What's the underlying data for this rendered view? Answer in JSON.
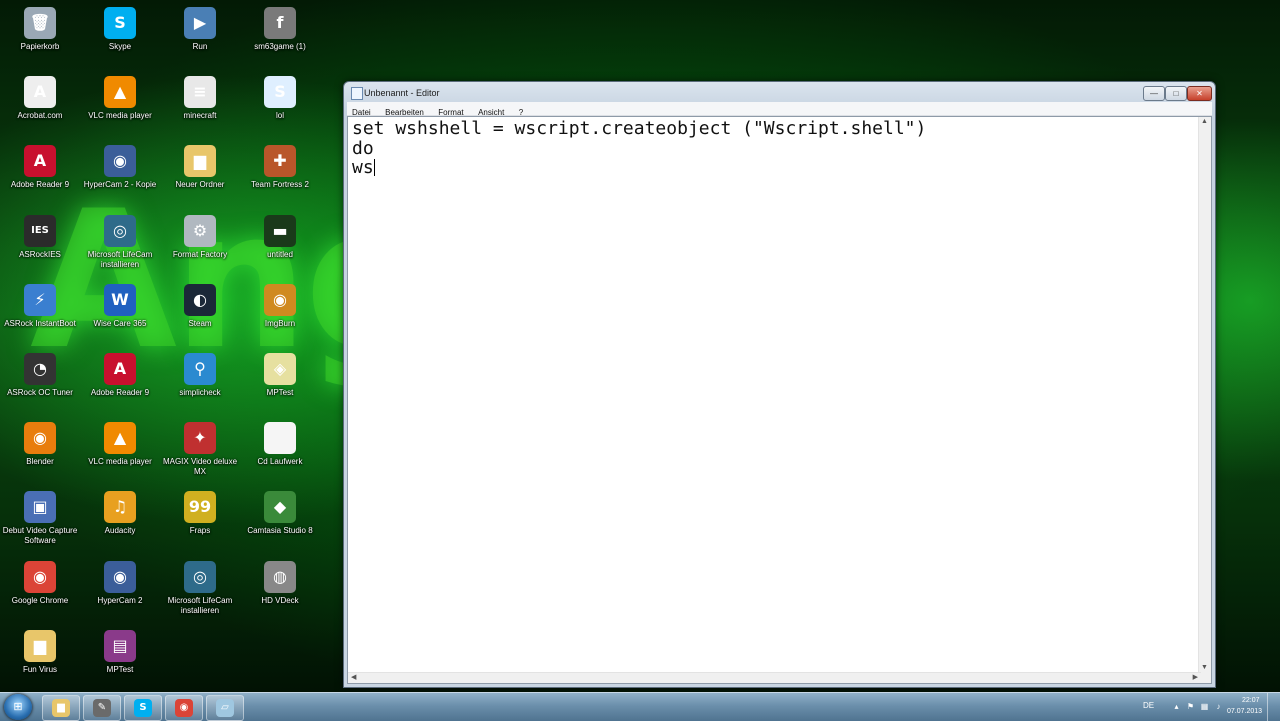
{
  "desktop": {
    "wallpaper_text": "Angry",
    "icons": [
      {
        "label": "Papierkorb",
        "icon": "recycle-bin-icon",
        "glyph": "🗑",
        "color": "#9aa8b5"
      },
      {
        "label": "Skype",
        "icon": "skype-icon",
        "glyph": "S",
        "color": "#00aff0"
      },
      {
        "label": "Run",
        "icon": "run-icon",
        "glyph": "▶",
        "color": "#4a7fb5"
      },
      {
        "label": "sm63game (1)",
        "icon": "flash-icon",
        "glyph": "f",
        "color": "#7a7a7a"
      },
      {
        "label": "Acrobat.com",
        "icon": "acrobat-icon",
        "glyph": "A",
        "color": "#eeeeee"
      },
      {
        "label": "VLC media player",
        "icon": "vlc-icon",
        "glyph": "▲",
        "color": "#f08a00"
      },
      {
        "label": "minecraft",
        "icon": "file-icon",
        "glyph": "≡",
        "color": "#e8e8e8"
      },
      {
        "label": "lol",
        "icon": "script-icon",
        "glyph": "S",
        "color": "#dfefff"
      },
      {
        "label": "Adobe Reader 9",
        "icon": "adobe-reader-icon",
        "glyph": "A",
        "color": "#c8102e"
      },
      {
        "label": "HyperCam 2 - Kopie",
        "icon": "hypercam-icon",
        "glyph": "◉",
        "color": "#3b5e99"
      },
      {
        "label": "Neuer Ordner",
        "icon": "folder-icon",
        "glyph": "▆",
        "color": "#e8c66a"
      },
      {
        "label": "Team Fortress 2",
        "icon": "tf2-icon",
        "glyph": "✚",
        "color": "#b9562a"
      },
      {
        "label": "ASRockIES",
        "icon": "asrock-ies-icon",
        "glyph": "IES",
        "color": "#2b2b2b"
      },
      {
        "label": "Microsoft LifeCam installieren",
        "icon": "lifecam-icon",
        "glyph": "◎",
        "color": "#2e6b8a"
      },
      {
        "label": "Format Factory",
        "icon": "format-factory-icon",
        "glyph": "⚙",
        "color": "#b0b8c0"
      },
      {
        "label": "untitled",
        "icon": "image-icon",
        "glyph": "▬",
        "color": "#1a3a1a"
      },
      {
        "label": "ASRock InstantBoot",
        "icon": "instantboot-icon",
        "glyph": "⚡",
        "color": "#3a7fd0"
      },
      {
        "label": "Wise Care 365",
        "icon": "wisecare-icon",
        "glyph": "W",
        "color": "#2060c0"
      },
      {
        "label": "Steam",
        "icon": "steam-icon",
        "glyph": "◐",
        "color": "#1b2838"
      },
      {
        "label": "ImgBurn",
        "icon": "imgburn-icon",
        "glyph": "◉",
        "color": "#d08a20"
      },
      {
        "label": "ASRock OC Tuner",
        "icon": "oc-tuner-icon",
        "glyph": "◔",
        "color": "#333333"
      },
      {
        "label": "Adobe Reader 9",
        "icon": "adobe-reader-icon",
        "glyph": "A",
        "color": "#c8102e"
      },
      {
        "label": "simplicheck",
        "icon": "magnifier-icon",
        "glyph": "⚲",
        "color": "#2a8ad0"
      },
      {
        "label": "MPTest",
        "icon": "unity-icon",
        "glyph": "◈",
        "color": "#e6e0a0"
      },
      {
        "label": "Blender",
        "icon": "blender-icon",
        "glyph": "◉",
        "color": "#e87d0d"
      },
      {
        "label": "VLC media player",
        "icon": "vlc-icon",
        "glyph": "▲",
        "color": "#f08a00"
      },
      {
        "label": "MAGIX Video deluxe MX",
        "icon": "magix-icon",
        "glyph": "✦",
        "color": "#c03030"
      },
      {
        "label": "Cd Laufwerk",
        "icon": "blank-file-icon",
        "glyph": "",
        "color": "#f5f5f5"
      },
      {
        "label": "Debut Video Capture Software",
        "icon": "debut-icon",
        "glyph": "▣",
        "color": "#4a6fb5"
      },
      {
        "label": "Audacity",
        "icon": "audacity-icon",
        "glyph": "♫",
        "color": "#e8a020"
      },
      {
        "label": "Fraps",
        "icon": "fraps-icon",
        "glyph": "99",
        "color": "#d0b020"
      },
      {
        "label": "Camtasia Studio 8",
        "icon": "camtasia-icon",
        "glyph": "◆",
        "color": "#3a8a3a"
      },
      {
        "label": "Google Chrome",
        "icon": "chrome-icon",
        "glyph": "◉",
        "color": "#db4437"
      },
      {
        "label": "HyperCam 2",
        "icon": "hypercam-icon",
        "glyph": "◉",
        "color": "#3b5e99"
      },
      {
        "label": "Microsoft LifeCam installieren",
        "icon": "lifecam-icon",
        "glyph": "◎",
        "color": "#2e6b8a"
      },
      {
        "label": "HD VDeck",
        "icon": "hdvdeck-icon",
        "glyph": "◍",
        "color": "#888888"
      },
      {
        "label": "Fun Virus",
        "icon": "folder-icon",
        "glyph": "▆",
        "color": "#e8c66a"
      },
      {
        "label": "MPTest",
        "icon": "winrar-icon",
        "glyph": "▤",
        "color": "#8a3a8a"
      }
    ]
  },
  "window": {
    "title": "Unbenannt - Editor",
    "buttons": {
      "minimize": "—",
      "maximize": "□",
      "close": "✕"
    },
    "menu": [
      "Datei",
      "Bearbeiten",
      "Format",
      "Ansicht",
      "?"
    ],
    "content_lines": [
      "set wshshell = wscript.createobject (\"Wscript.shell\")",
      "do",
      "ws"
    ]
  },
  "taskbar": {
    "start_label": "⊞",
    "apps": [
      {
        "icon": "explorer-icon",
        "glyph": "▆",
        "color": "#e8c66a"
      },
      {
        "icon": "paint-icon",
        "glyph": "✎",
        "color": "#6a6a6a"
      },
      {
        "icon": "skype-icon",
        "glyph": "S",
        "color": "#00aff0"
      },
      {
        "icon": "chrome-icon",
        "glyph": "◉",
        "color": "#db4437"
      },
      {
        "icon": "notepad-icon",
        "glyph": "▱",
        "color": "#9fc7e0"
      }
    ],
    "tray": {
      "language": "DE",
      "time": "22:07",
      "date": "07.07.2013"
    }
  }
}
